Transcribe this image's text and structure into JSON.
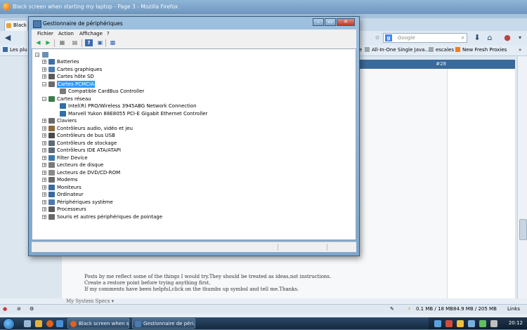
{
  "firefox": {
    "window_title": "Black screen when starting my laptop - Page 3 - Mozilla Firefox",
    "tab_label": "Black",
    "search_placeholder": "Google",
    "search_engine_letter": "g",
    "bookmarks": [
      {
        "label": "Les plu"
      },
      {
        "label": "ie"
      },
      {
        "label": "All-In-One Single Java..."
      },
      {
        "label": "escales"
      },
      {
        "label": "New Fresh Proxies"
      },
      {
        "label": "»"
      }
    ],
    "post_number": "#28",
    "signature_lines": [
      "Posts by me reflect some of the things I would try.They should be treated as ideas,not instructions.",
      "Create a restore point before trying anything first.",
      "If my comments have been helpful,click on the thumbs up symbol and tell me.Thanks."
    ],
    "system_specs": "My System Specs ▾",
    "status_memory_1": "0.1 MB / 18 MB",
    "status_memory_2": "84.9 MB / 205 MB",
    "status_links": "Links"
  },
  "device_manager": {
    "title": "Gestionnaire de périphériques",
    "menu": [
      "Fichier",
      "Action",
      "Affichage",
      "?"
    ],
    "tree": [
      {
        "label": "Batteries",
        "level": 1,
        "expander": "+",
        "icon_color": "#3c6fa8"
      },
      {
        "label": "Cartes graphiques",
        "level": 1,
        "expander": "+",
        "icon_color": "#4c7db3"
      },
      {
        "label": "Cartes hôte SD",
        "level": 1,
        "expander": "+",
        "icon_color": "#5a5a5a"
      },
      {
        "label": "Cartes PCMCIA",
        "level": 1,
        "expander": "−",
        "icon_color": "#6b6b6b",
        "selected": true
      },
      {
        "label": "Compatible CardBus Controller",
        "level": 2,
        "expander": "",
        "icon_color": "#7a7a7a"
      },
      {
        "label": "Cartes réseau",
        "level": 1,
        "expander": "−",
        "icon_color": "#3d7a4a"
      },
      {
        "label": "Intel(R) PRO/Wireless 3945ABG Network Connection",
        "level": 2,
        "expander": "",
        "icon_color": "#2f6ea8"
      },
      {
        "label": "Marvell Yukon 88E8055 PCI-E Gigabit Ethernet Controller",
        "level": 2,
        "expander": "",
        "icon_color": "#2f6ea8"
      },
      {
        "label": "Claviers",
        "level": 1,
        "expander": "+",
        "icon_color": "#6a6a6a"
      },
      {
        "label": "Contrôleurs audio, vidéo et jeu",
        "level": 1,
        "expander": "+",
        "icon_color": "#8a6a3a"
      },
      {
        "label": "Contrôleurs de bus USB",
        "level": 1,
        "expander": "+",
        "icon_color": "#4a4a4a"
      },
      {
        "label": "Contrôleurs de stockage",
        "level": 1,
        "expander": "+",
        "icon_color": "#5a6a7a"
      },
      {
        "label": "Contrôleurs IDE ATA/ATAPI",
        "level": 1,
        "expander": "+",
        "icon_color": "#5a6a7a"
      },
      {
        "label": "Filter Device",
        "level": 1,
        "expander": "+",
        "icon_color": "#3a7ab0"
      },
      {
        "label": "Lecteurs de disque",
        "level": 1,
        "expander": "+",
        "icon_color": "#7a7a7a"
      },
      {
        "label": "Lecteurs de DVD/CD-ROM",
        "level": 1,
        "expander": "+",
        "icon_color": "#8a8a8a"
      },
      {
        "label": "Modems",
        "level": 1,
        "expander": "+",
        "icon_color": "#6a6a6a"
      },
      {
        "label": "Moniteurs",
        "level": 1,
        "expander": "+",
        "icon_color": "#3a6aa0"
      },
      {
        "label": "Ordinateur",
        "level": 1,
        "expander": "+",
        "icon_color": "#3a6aa0"
      },
      {
        "label": "Périphériques système",
        "level": 1,
        "expander": "+",
        "icon_color": "#4a7ab0"
      },
      {
        "label": "Processeurs",
        "level": 1,
        "expander": "+",
        "icon_color": "#5a5a5a"
      },
      {
        "label": "Souris et autres périphériques de pointage",
        "level": 1,
        "expander": "+",
        "icon_color": "#6a6a6a"
      }
    ]
  },
  "taskbar": {
    "buttons": [
      {
        "label": "Black screen when s...",
        "icon_color": "#e0621c"
      },
      {
        "label": "Gestionnaire de péri...",
        "icon_color": "#4a7ab0"
      }
    ],
    "clock": "20:12"
  }
}
